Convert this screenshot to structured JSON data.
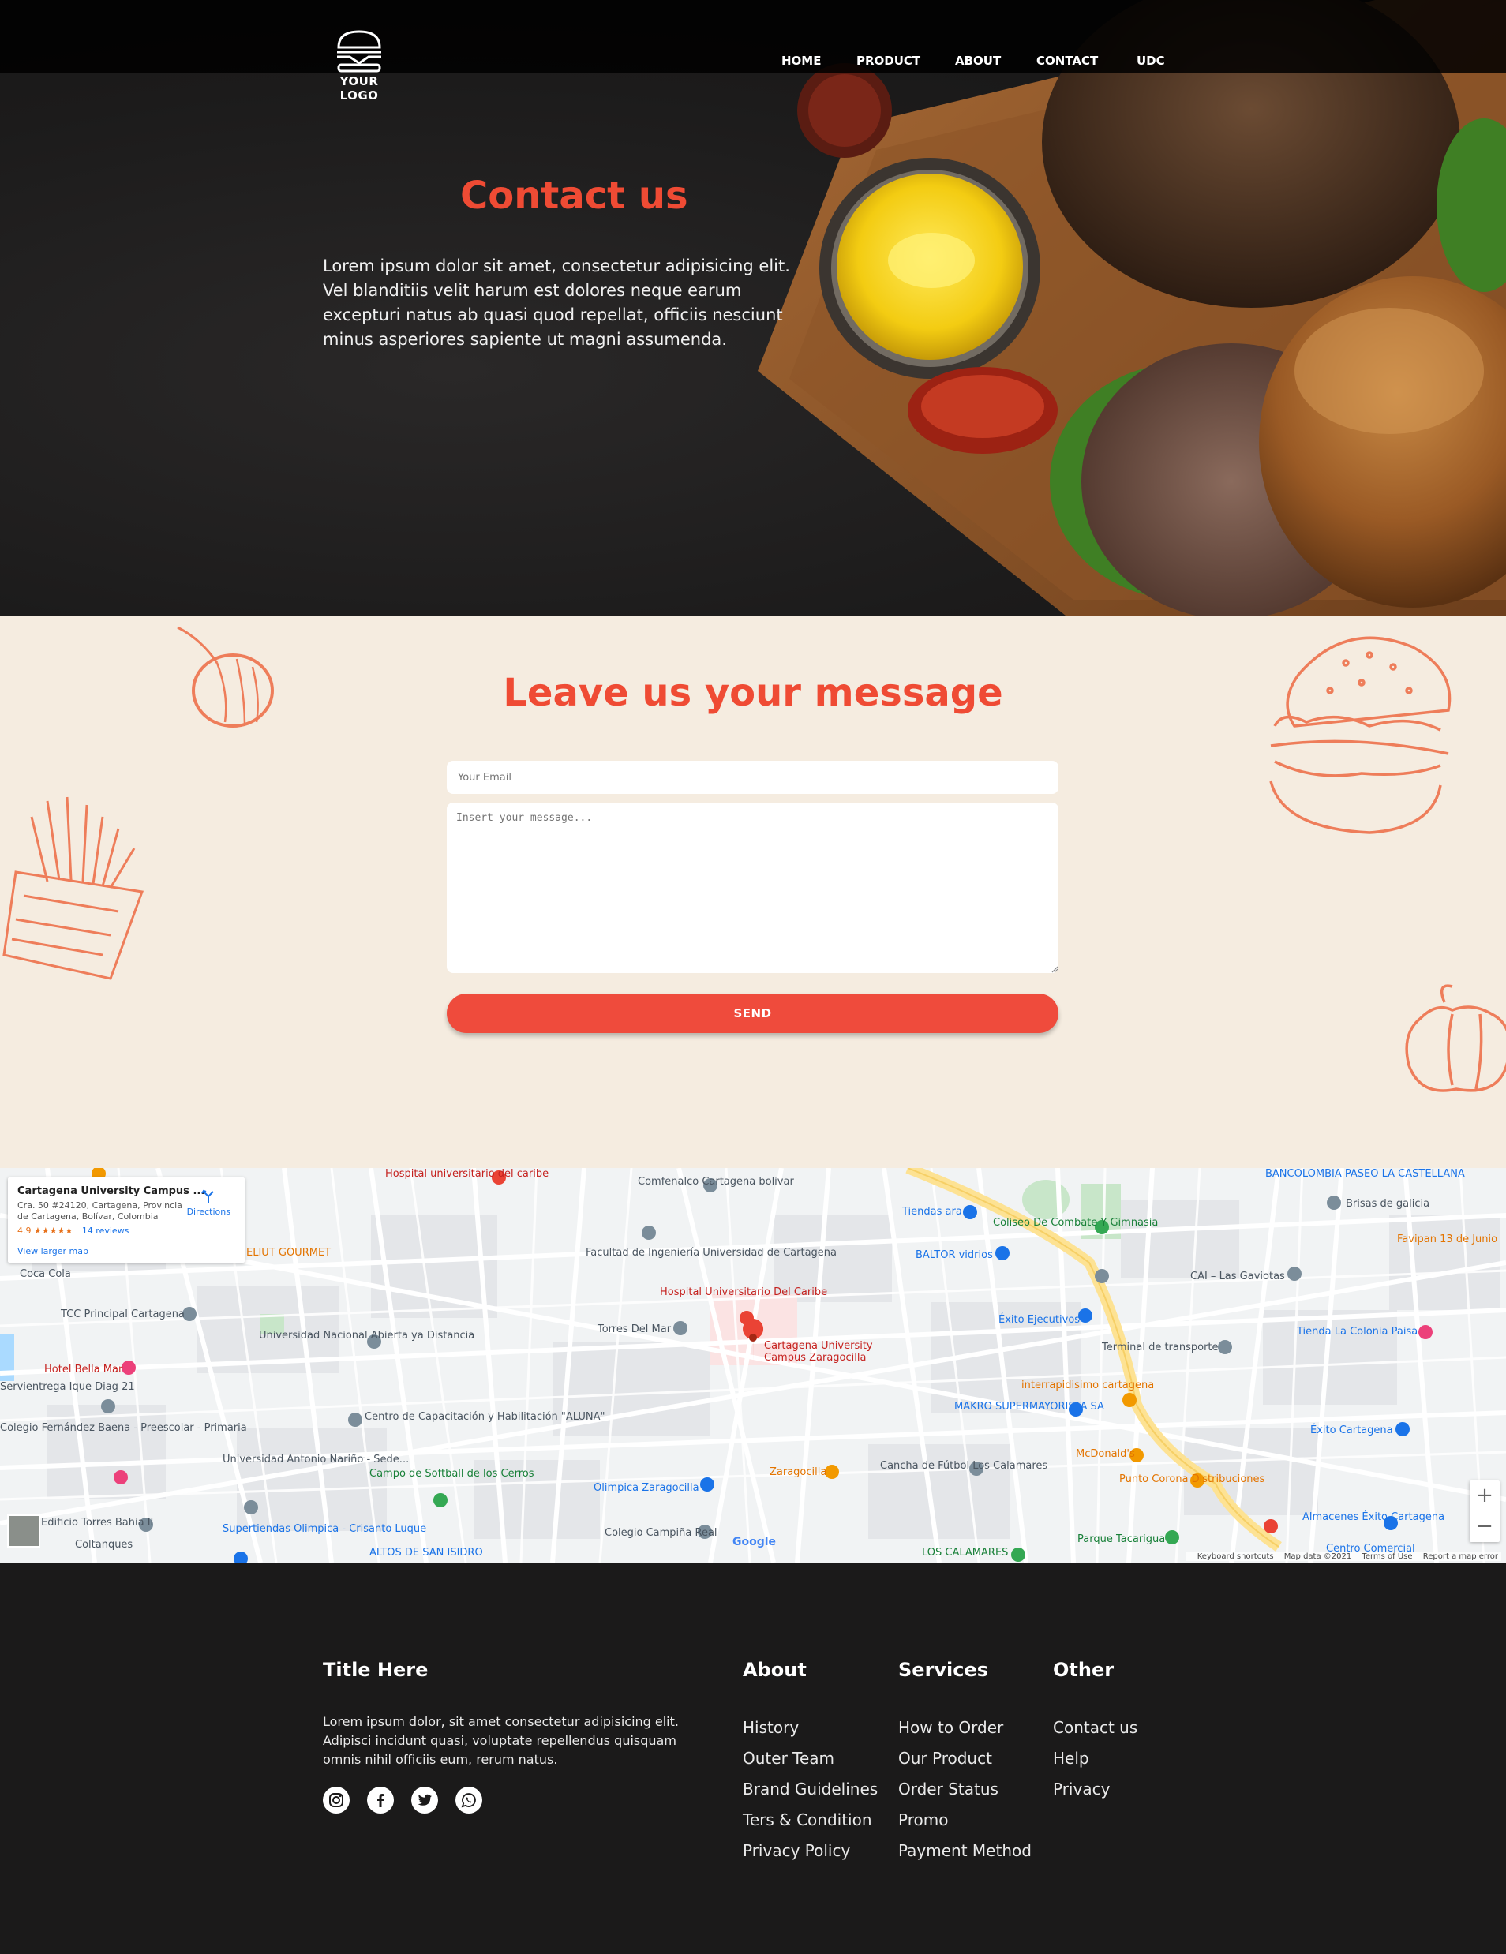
{
  "header": {
    "logo_text": "YOUR LOGO",
    "nav": [
      "HOME",
      "PRODUCT",
      "ABOUT",
      "CONTACT",
      "UDC"
    ]
  },
  "hero": {
    "title": "Contact us",
    "text": "Lorem ipsum dolor sit amet, consectetur adipisicing elit. Vel blanditiis velit harum est dolores neque earum excepturi natus ab quasi quod repellat, officiis nesciunt minus asperiores sapiente ut magni assumenda."
  },
  "form": {
    "title": "Leave us your message",
    "email_placeholder": "Your Email",
    "message_placeholder": "Insert your message...",
    "send_label": "SEND"
  },
  "map": {
    "place_name": "Cartagena University Campus ...",
    "address": "Cra. 50 #24120, Cartagena, Provincia de Cartagena, Bolívar, Colombia",
    "rating": "4.9",
    "stars": "★★★★★",
    "reviews": "14 reviews",
    "view_larger": "View larger map",
    "directions": "Directions",
    "pin_label_1": "Cartagena University",
    "pin_label_2": "Campus Zaragocilla",
    "labels": [
      "Hospital universitario del caribe",
      "Comfenalco Cartagena bolivar",
      "Tiendas ara",
      "Coliseo De Combate Y Gimnasia",
      "BANCOLOMBIA PASEO LA CASTELLANA",
      "Brisas de galicia",
      "Favipan 13 de Junio",
      "Facultad de Ingeniería Universidad de Cartagena",
      "BALTOR vidrios",
      "CAI – Las Gaviotas",
      "ELIUT GOURMET",
      "Coca Cola",
      "Hospital Universitario Del Caribe",
      "Éxito Ejecutivos",
      "TCC Principal Cartagena",
      "Torres Del Mar",
      "Universidad Nacional Abierta ya Distancia",
      "Terminal de transporte",
      "Tienda La Colonia Paisa",
      "Hotel Bella Mar",
      "interrapidisimo cartagena",
      "MAKRO SUPERMAYORISTA SA",
      "Servientrega Ique Diag 21",
      "Centro de Capacitación y Habilitación \"ALUNA\"",
      "Éxito Cartagena",
      "Colegio Fernández Baena - Preescolar - Primaria",
      "McDonald's",
      "Universidad Antonio Nariño - Sede...",
      "Cancha de Fútbol Los Calamares",
      "Campo de Softball de los Cerros",
      "Zaragocilla",
      "Punto Corona Distribuciones",
      "Olimpica Zaragocilla",
      "Edificio Torres Bahia II",
      "Coltanques",
      "Supertiendas Olimpica - Crisanto Luque",
      "Colegio Campiña Real",
      "Parque Tacarigua",
      "Almacenes Éxito Cartagena",
      "ALTOS DE SAN ISIDRO",
      "LOS CALAMARES",
      "Centro Comercial"
    ],
    "attribution": [
      "Keyboard shortcuts",
      "Map data ©2021",
      "Terms of Use",
      "Report a map error"
    ],
    "google": "Google"
  },
  "footer": {
    "title": "Title Here",
    "text": "Lorem ipsum dolor, sit amet consectetur adipisicing elit. Adipisci incidunt quasi, voluptate repellendus quisquam omnis nihil officiis eum, rerum natus.",
    "socials": [
      "instagram-icon",
      "facebook-icon",
      "twitter-icon",
      "whatsapp-icon"
    ],
    "about": {
      "title": "About",
      "links": [
        "History",
        "Outer Team",
        "Brand Guidelines",
        "Ters & Condition",
        "Privacy Policy"
      ]
    },
    "services": {
      "title": "Services",
      "links": [
        "How to Order",
        "Our Product",
        "Order Status",
        "Promo",
        "Payment Method"
      ]
    },
    "other": {
      "title": "Other",
      "links": [
        "Contact us",
        "Help",
        "Privacy"
      ]
    }
  },
  "colors": {
    "accent": "#ef4b34",
    "cream": "#f5ece0",
    "dark": "#1b1a1a"
  }
}
